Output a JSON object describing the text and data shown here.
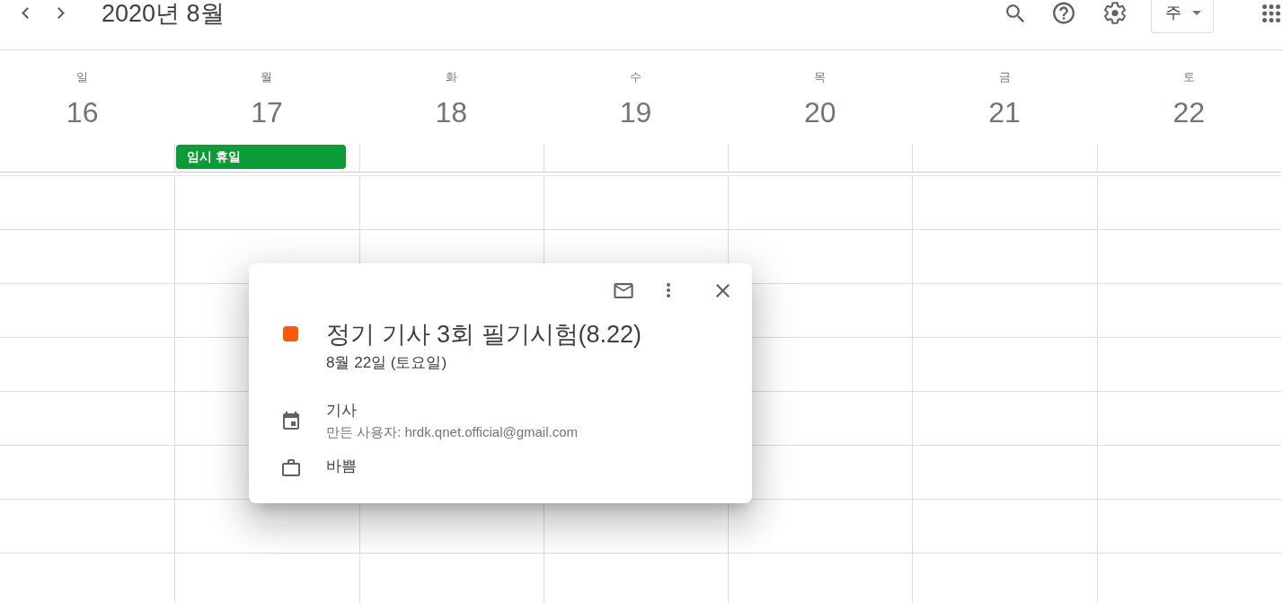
{
  "header": {
    "title": "2020년 8월",
    "view_switcher": {
      "label": "주"
    }
  },
  "days": [
    {
      "weekday": "일",
      "date": "16"
    },
    {
      "weekday": "월",
      "date": "17",
      "all_day_events": [
        {
          "title": "임시 휴일",
          "color": "#0b9b37"
        }
      ]
    },
    {
      "weekday": "화",
      "date": "18"
    },
    {
      "weekday": "수",
      "date": "19"
    },
    {
      "weekday": "목",
      "date": "20"
    },
    {
      "weekday": "금",
      "date": "21"
    },
    {
      "weekday": "토",
      "date": "22"
    }
  ],
  "popup": {
    "color": "#fb5a06",
    "title": "정기 기사 3회 필기시험(8.22)",
    "date": "8월 22일 (토요일)",
    "details": [
      {
        "kind": "calendar",
        "label": "기사",
        "creator": "만든 사용자: hrdk.qnet.official@gmail.com"
      },
      {
        "kind": "availability",
        "label": "바쁨"
      }
    ]
  }
}
